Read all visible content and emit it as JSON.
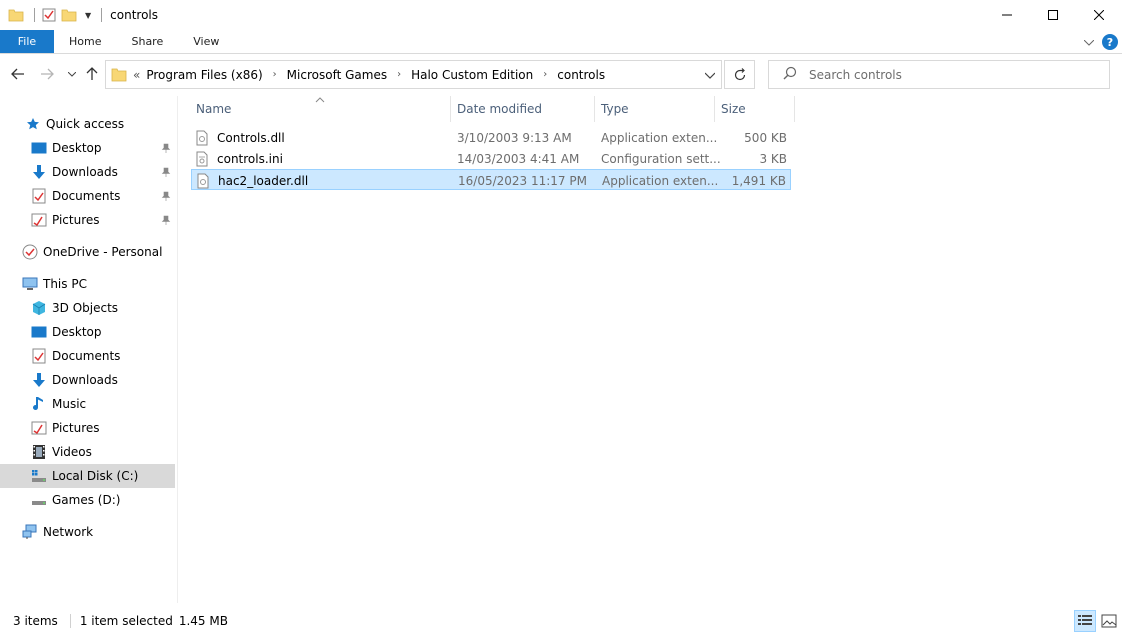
{
  "window": {
    "title": "controls"
  },
  "ribbon": {
    "file": "File",
    "tabs": [
      "Home",
      "Share",
      "View"
    ]
  },
  "address": {
    "overflow": "«",
    "crumbs": [
      "Program Files (x86)",
      "Microsoft Games",
      "Halo Custom Edition",
      "controls"
    ]
  },
  "search": {
    "placeholder": "Search controls"
  },
  "sidebar": {
    "quick_access": "Quick access",
    "quick_items": [
      "Desktop",
      "Downloads",
      "Documents",
      "Pictures"
    ],
    "onedrive": "OneDrive - Personal",
    "this_pc": "This PC",
    "pc_items": [
      "3D Objects",
      "Desktop",
      "Documents",
      "Downloads",
      "Music",
      "Pictures",
      "Videos",
      "Local Disk (C:)",
      "Games (D:)"
    ],
    "network": "Network"
  },
  "columns": {
    "name": "Name",
    "date": "Date modified",
    "type": "Type",
    "size": "Size"
  },
  "files": [
    {
      "name": "Controls.dll",
      "date": "3/10/2003 9:13 AM",
      "type": "Application exten...",
      "size": "500 KB"
    },
    {
      "name": "controls.ini",
      "date": "14/03/2003 4:41 AM",
      "type": "Configuration sett...",
      "size": "3 KB"
    },
    {
      "name": "hac2_loader.dll",
      "date": "16/05/2023 11:17 PM",
      "type": "Application exten...",
      "size": "1,491 KB"
    }
  ],
  "status": {
    "count": "3 items",
    "selected": "1 item selected",
    "size": "1.45 MB"
  },
  "colors": {
    "accent": "#1979ca",
    "selection": "#cce8ff",
    "selection_border": "#99d1ff",
    "folder": "#f8d775",
    "header_text": "#4c607a"
  }
}
